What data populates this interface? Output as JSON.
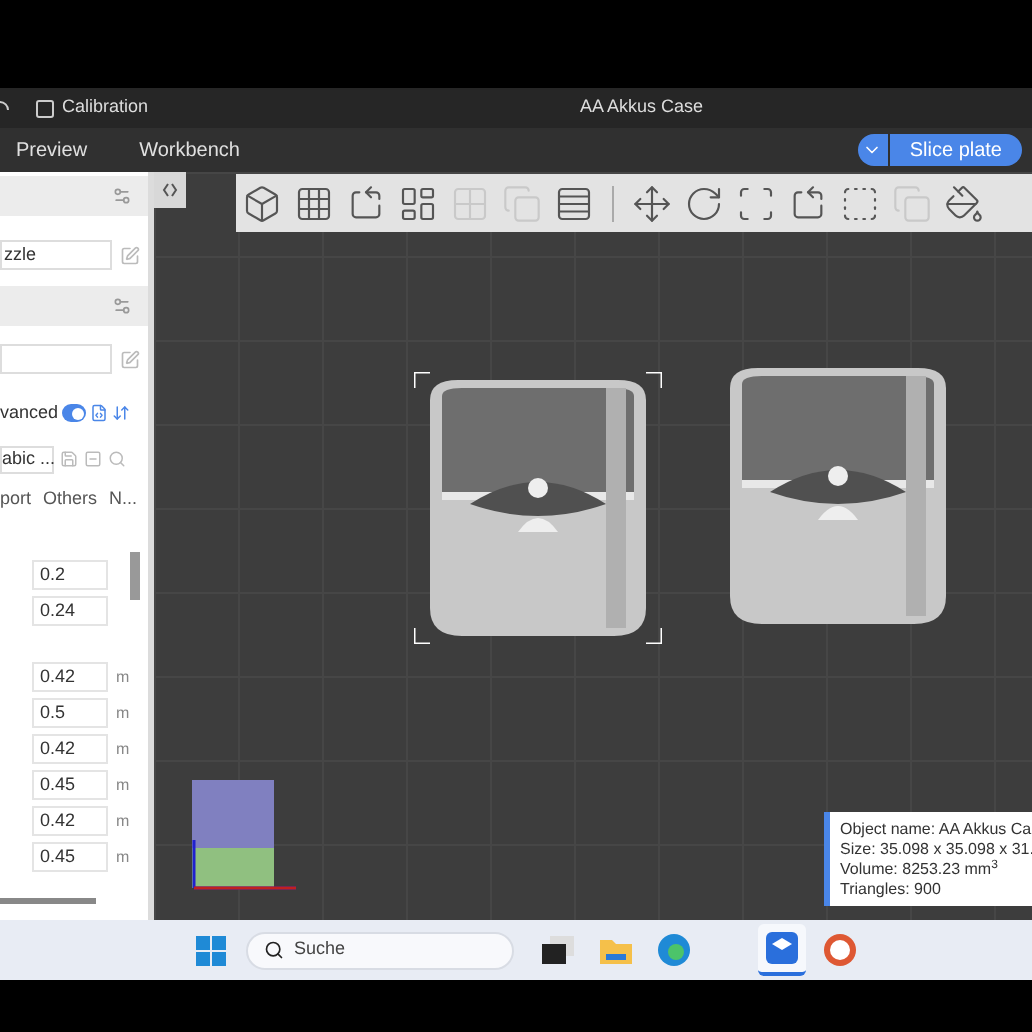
{
  "window": {
    "title": "AA Akkus Case"
  },
  "title_bar": {
    "menu": "Calibration"
  },
  "tabs": [
    {
      "label": "Preview"
    },
    {
      "label": "Workbench"
    }
  ],
  "slice_button": {
    "label": "Slice plate"
  },
  "toolbar_tools": [
    {
      "kind": "add-cube",
      "disabled": false
    },
    {
      "kind": "grid",
      "disabled": false
    },
    {
      "kind": "auto-orient",
      "disabled": false
    },
    {
      "kind": "arrange",
      "disabled": false
    },
    {
      "kind": "split-objects",
      "disabled": true
    },
    {
      "kind": "split-parts",
      "disabled": true
    },
    {
      "kind": "layers",
      "disabled": false
    },
    {
      "kind": "move",
      "disabled": false
    },
    {
      "kind": "rotate",
      "disabled": false
    },
    {
      "kind": "scale",
      "disabled": false
    },
    {
      "kind": "lay-flat",
      "disabled": false
    },
    {
      "kind": "cut",
      "disabled": false
    },
    {
      "kind": "boolean",
      "disabled": true
    },
    {
      "kind": "paint",
      "disabled": false
    }
  ],
  "sidebar": {
    "nozzle_field": {
      "value": "zzle"
    },
    "advanced": {
      "label": "vanced",
      "on": true
    },
    "preset": {
      "value": "abic ..."
    },
    "tabs": [
      {
        "label": "port"
      },
      {
        "label": "Others"
      },
      {
        "label": "N..."
      }
    ],
    "groups": [
      [
        {
          "value": "0.2"
        },
        {
          "value": "0.24"
        }
      ],
      [
        {
          "value": "0.42",
          "unit": "m"
        },
        {
          "value": "0.5",
          "unit": "m"
        },
        {
          "value": "0.42",
          "unit": "m"
        },
        {
          "value": "0.45",
          "unit": "m"
        },
        {
          "value": "0.42",
          "unit": "m"
        },
        {
          "value": "0.45",
          "unit": "m"
        }
      ]
    ]
  },
  "info_box": {
    "lines": [
      "Object name: AA Akkus Ca",
      "Size: 35.098 x 35.098 x 31.",
      "Volume: 8253.23 mm$^{3}$",
      "Triangles: 900"
    ]
  },
  "taskbar": {
    "search": {
      "placeholder": "Suche"
    },
    "apps": [
      {
        "kind": "task-view",
        "selected": false
      },
      {
        "kind": "folder",
        "selected": false
      },
      {
        "kind": "browser",
        "selected": false
      },
      {
        "kind": "slicer",
        "selected": true
      },
      {
        "kind": "duck",
        "selected": false
      }
    ]
  }
}
